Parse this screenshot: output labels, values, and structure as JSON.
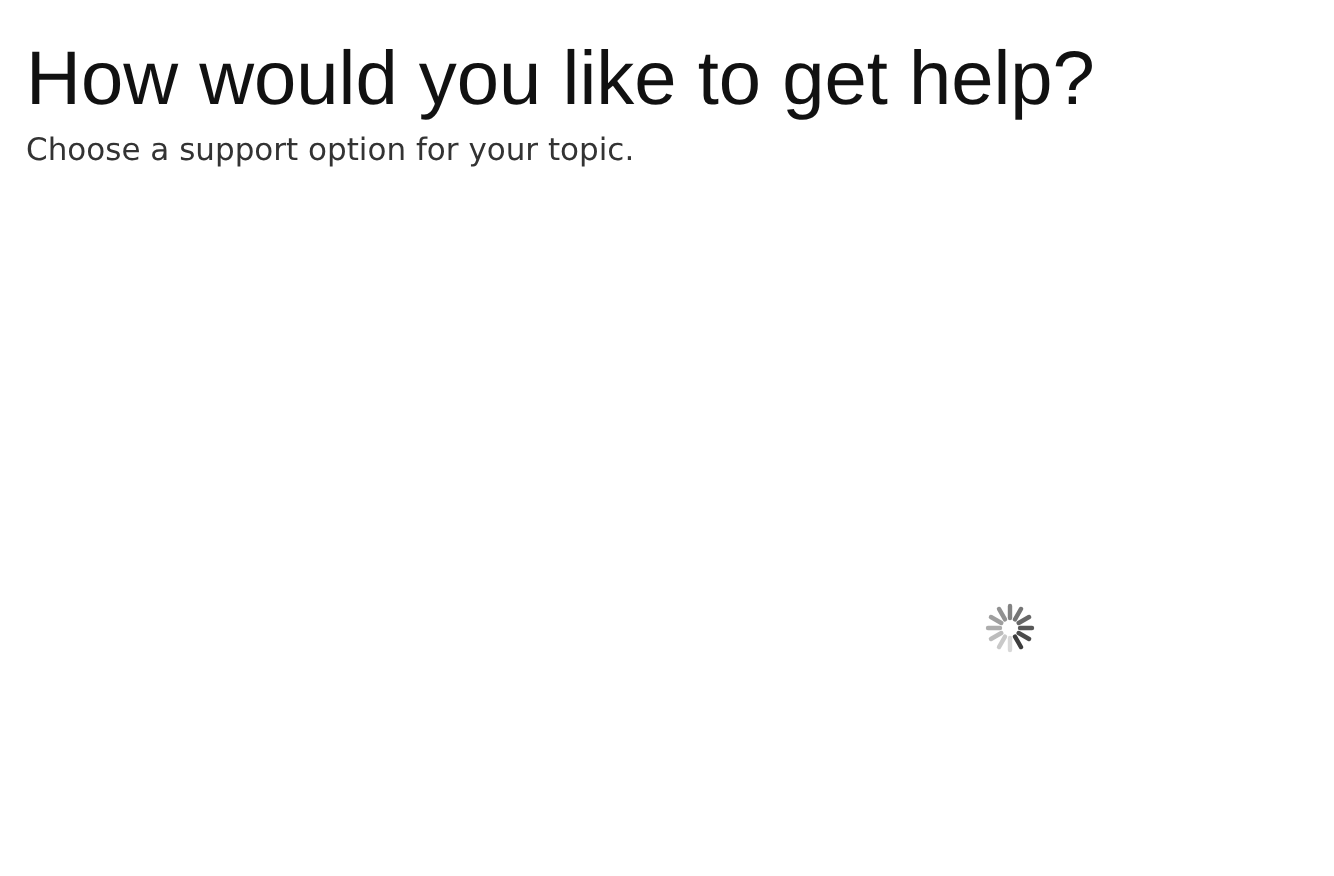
{
  "heading": {
    "title": "How would you like to get help?",
    "subtitle": "Choose a support option for your topic."
  },
  "loading": true
}
